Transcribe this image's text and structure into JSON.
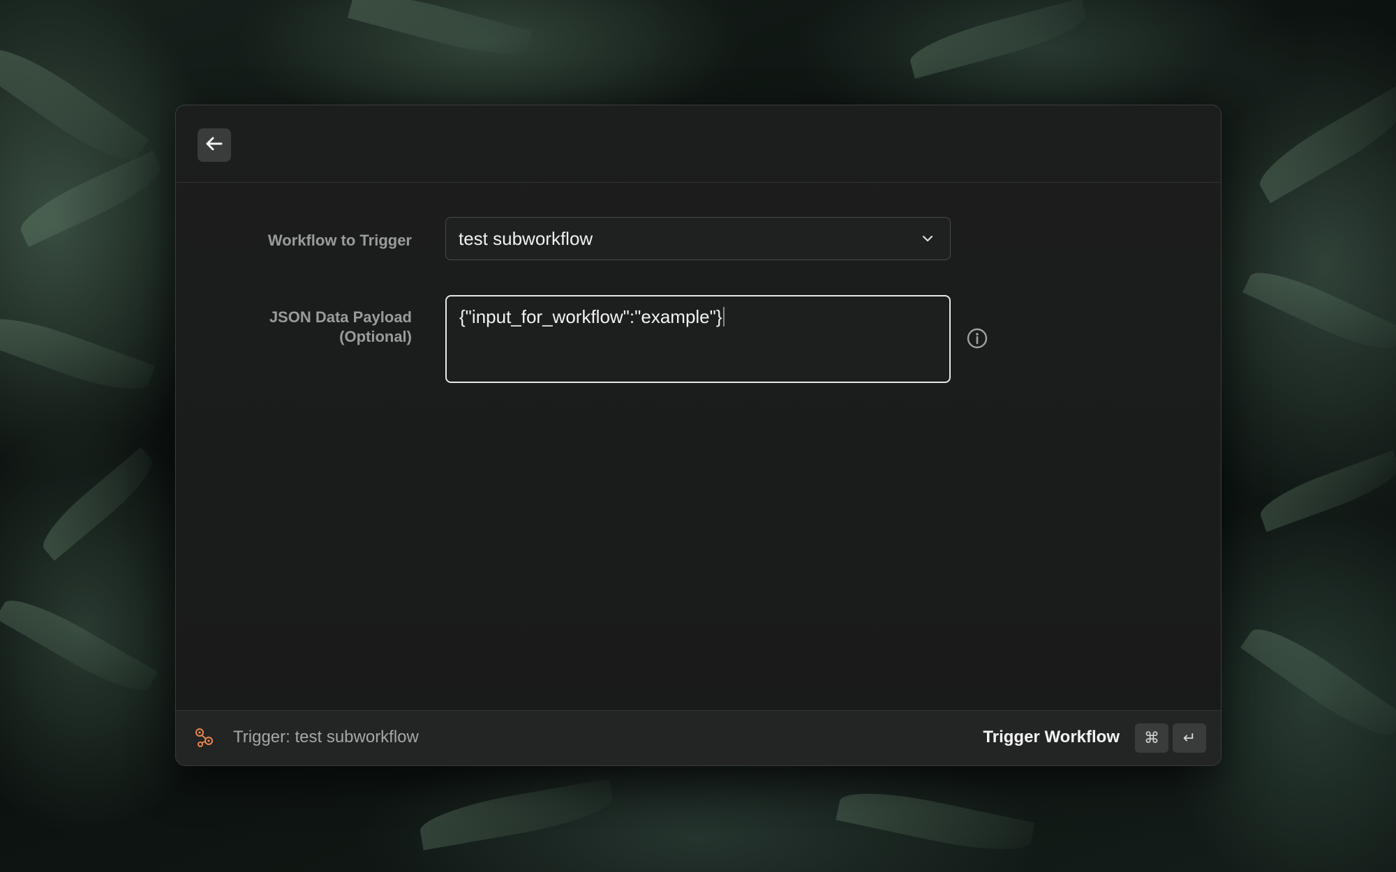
{
  "window": {
    "back_icon": "arrow-left-icon"
  },
  "form": {
    "workflow_label": "Workflow to Trigger",
    "workflow_value": "test subworkflow",
    "payload_label_line1": "JSON Data Payload",
    "payload_label_line2": "(Optional)",
    "payload_value": "{\"input_for_workflow\":\"example\"}",
    "info_icon": "info-circle-icon"
  },
  "footer": {
    "title": "Trigger: test subworkflow",
    "action_label": "Trigger Workflow",
    "shortcut_modifier": "⌘",
    "shortcut_key": "↵",
    "app_icon": "workflow-gears-icon",
    "accent_color": "#e8874c"
  }
}
